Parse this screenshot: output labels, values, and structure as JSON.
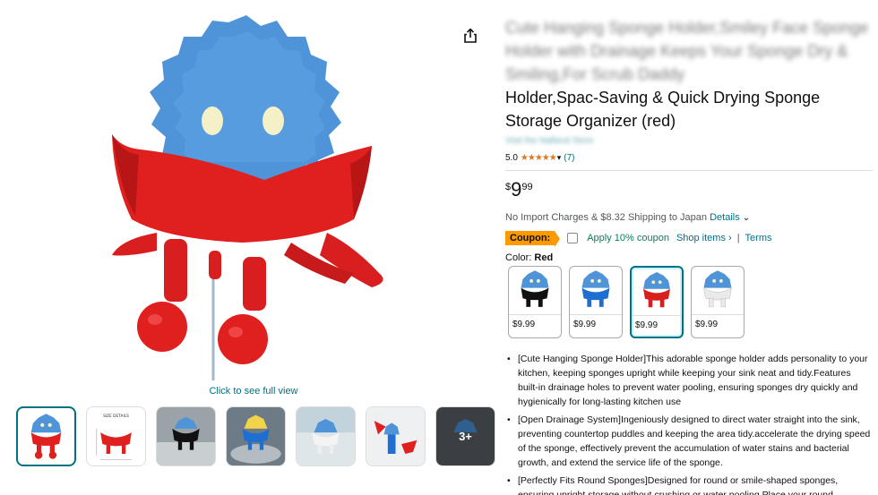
{
  "gallery": {
    "click_full_label": "Click to see full view",
    "thumbnails": [
      {
        "name": "thumb-sponge-holder-red",
        "selected": true
      },
      {
        "name": "thumb-size-details",
        "selected": false
      },
      {
        "name": "thumb-sink-black",
        "selected": false
      },
      {
        "name": "thumb-yellow-sponge",
        "selected": false
      },
      {
        "name": "thumb-window-blue",
        "selected": false
      },
      {
        "name": "thumb-wall-red",
        "selected": false
      },
      {
        "name": "thumb-more",
        "selected": false
      }
    ],
    "more_label": "3+",
    "size_details_label": "SIZE DETAILS"
  },
  "product": {
    "title_blurred": "Cute Hanging Sponge Holder,Smiley Face Sponge Holder with Drainage Keeps Your Sponge Dry & Smiling,For Scrub Daddy",
    "title_clear": "Holder,Spac-Saving & Quick Drying Sponge Storage Organizer (red)",
    "store_link": "Visit the Nalland Store",
    "rating": "5.0",
    "stars": "★★★★★",
    "review_count": "(7)",
    "price_symbol": "$",
    "price_whole": "9",
    "price_fraction": "99",
    "shipping_text": "No Import Charges & $8.32 Shipping to Japan",
    "details_label": "Details",
    "coupon": {
      "badge": "Coupon:",
      "apply_text": "Apply 10% coupon",
      "shop_items": "Shop items ›",
      "separator": "|",
      "terms": "Terms"
    },
    "color_label": "Color:",
    "color_value": "Red",
    "swatches": [
      {
        "color": "Black",
        "price": "$9.99",
        "holder_hex": "#111111",
        "selected": false
      },
      {
        "color": "Blue",
        "price": "$9.99",
        "holder_hex": "#1f6fd1",
        "selected": false
      },
      {
        "color": "Red",
        "price": "$9.99",
        "holder_hex": "#d81e1e",
        "selected": true
      },
      {
        "color": "White",
        "price": "$9.99",
        "holder_hex": "#f2f2f2",
        "selected": false
      }
    ],
    "bullets": [
      "[Cute Hanging Sponge Holder]This adorable sponge holder adds personality to your kitchen, keeping sponges upright while keeping your sink neat and tidy.Features built-in drainage holes to prevent water pooling, ensuring sponges dry quickly and hygienically for long-lasting kitchen use",
      "[Open Drainage System]Ingeniously designed to direct water straight into the sink, preventing countertop puddles and keeping the area tidy.accelerate the drying speed of the sponge, effectively prevent the accumulation of water stains and bacterial growth, and extend the service life of the sponge.",
      "[Perfectly Fits Round Sponges]Designed for round or smile-shaped sponges, ensuring upright storage without crushing or water pooling.Place your round"
    ]
  },
  "colors": {
    "link": "#007185",
    "star": "#de7921",
    "coupon_badge": "#ff9900",
    "coupon_apply": "#067d62",
    "holder_red": "#e01f1f",
    "sponge_blue": "#4f93d8"
  }
}
